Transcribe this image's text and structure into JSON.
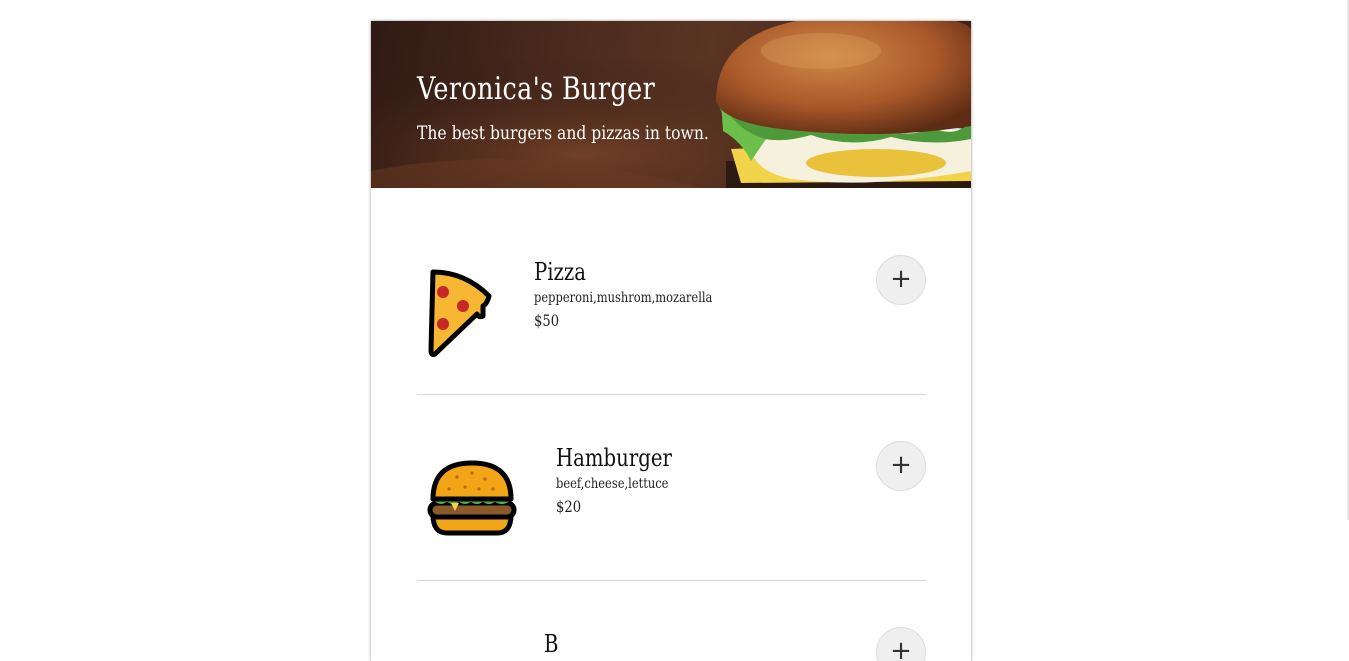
{
  "header": {
    "title": "Veronica's Burger",
    "subtitle": "The best burgers and pizzas in town."
  },
  "menu": {
    "items": [
      {
        "name": "Pizza",
        "ingredients": "pepperoni,mushrom,mozarella",
        "price": "$50",
        "icon": "pizza-slice-icon",
        "add_label": "+"
      },
      {
        "name": "Hamburger",
        "ingredients": "beef,cheese,lettuce",
        "price": "$20",
        "icon": "hamburger-icon",
        "add_label": "+"
      },
      {
        "name": "B",
        "add_label": "+"
      }
    ]
  },
  "colors": {
    "hero_dark": "#2f1a14",
    "bun": "#c97a33",
    "pizza_cheese": "#f7b733",
    "pepperoni": "#c62828",
    "button_bg": "#efefef"
  }
}
